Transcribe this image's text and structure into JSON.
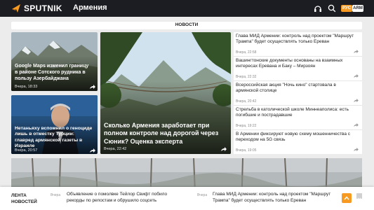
{
  "header": {
    "logo_text": "SPUTNIK",
    "region": "Армения",
    "lang_active": "РУС",
    "lang_alt": "ARM",
    "colors": {
      "background": "#1c1d22",
      "accent": "#f79a21"
    }
  },
  "tabs": {
    "news_label": "НОВОСТИ"
  },
  "cards": [
    {
      "title": "Google Maps изменил границу в районе Сотского рудника в пользу Азербайджана",
      "time": "Вчера, 18:33"
    },
    {
      "title": "Нетаньяху вспомнил о геноциде лишь в отместку Турции: главред армянской газеты в Израиле",
      "time": "Вчера, 20:57"
    },
    {
      "title": "Сколько Армения заработает при полном контроле над дорогой через Сюник? Оценка эксперта",
      "time": "Вчера, 22:42"
    }
  ],
  "news_list": [
    {
      "title": "Глава МИД Армении: контроль над проектом \"Маршрут Трампа\" будет осуществлять только Ереван",
      "time": "Вчера, 22:58"
    },
    {
      "title": "Вашингтонские документы основаны на взаимных интересах Еревана и Баку – Мирзоян",
      "time": "Вчера, 22:32"
    },
    {
      "title": "Всероссийская акция \"Ночь кино\" стартовала в армянской столице",
      "time": "Вчера, 20:42"
    },
    {
      "title": "Стрельба в католической школе Миннеаполиса: есть погибшие и пострадавшие",
      "time": "Вчера, 19:22"
    },
    {
      "title": "В Армении фиксируют новую схему мошенничества с переходом на 5G связь",
      "time": "Вчера, 19:05"
    }
  ],
  "ticker": {
    "label": "ЛЕНТА НОВОСТЕЙ",
    "items": [
      {
        "time": "Вчера",
        "text": "Объявление о помолвке Тейлор Свифт побило рекорды по репостам и обрушило соцсеть"
      },
      {
        "time": "Вчера",
        "text": "Глава МИД Армении: контроль над проектом \"Маршрут Трампа\" будет осуществлять только Ереван"
      }
    ]
  }
}
